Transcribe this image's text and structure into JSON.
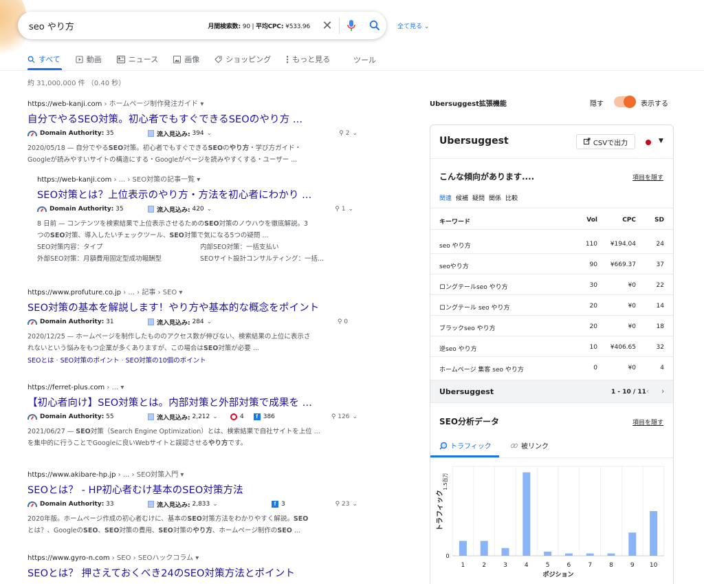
{
  "search": {
    "query": "seo やり方",
    "metrics_label": "月間検索数:",
    "metrics_volume": "90",
    "metrics_sep": " | ",
    "metrics_cpc_label": "平均CPC:",
    "metrics_cpc": "¥533.96",
    "clear_icon": "✕",
    "see_all": "全て見る",
    "see_all_caret": "⌄"
  },
  "tabs": [
    {
      "label": "すべて",
      "icon": "search-icon"
    },
    {
      "label": "動画",
      "icon": "play-icon"
    },
    {
      "label": "ニュース",
      "icon": "news-icon"
    },
    {
      "label": "画像",
      "icon": "image-icon"
    },
    {
      "label": "ショッピング",
      "icon": "tag-icon"
    },
    {
      "label": "もっと見る",
      "icon": "more-vert-icon"
    }
  ],
  "tools_label": "ツール",
  "result_count": "約 31,000,000 件 （0.40 秒）",
  "results": [
    {
      "url": "https://web-kanji.com",
      "breadcrumb": " › ホームページ制作発注ガイド ▾",
      "title": "自分でやるSEO対策。初心者でもすぐできるSEOのやり方 ...",
      "da_label": "Domain Authority:",
      "da": "35",
      "traffic_label": "流入見込み:",
      "traffic": "394",
      "links": "2",
      "snippet1": "2020/05/18 — 自分でやるSEO対策。初心者でもすぐできるSEOのやり方・学び方ガイド・",
      "snippet2": "Googleが読みやすいサイトの構造にする・Googleがページを読みやすくする・ユーザー ..."
    },
    {
      "url": "https://web-kanji.com",
      "breadcrumb": " › ... › SEO対策の記事一覧 ▾",
      "title": "SEO対策とは？上位表示のやり方・方法を初心者にわかり ...",
      "da_label": "Domain Authority:",
      "da": "35",
      "traffic_label": "流入見込み:",
      "traffic": "420",
      "links": "1",
      "snippet1": "8 日前 — コンテンツを検索結果で上位表示させるためのSEO対策のノウハウを徹底解説。3",
      "snippet2": "つのSEO対策、導入したいチェックツール、SEO対策で気になる5つの疑問 ...",
      "facts": [
        {
          "k": "SEO対策内容：",
          "v": "タイプ"
        },
        {
          "k": "内部SEO対策：",
          "v": "一括支払い"
        },
        {
          "k": "外部SEO対策：",
          "v": "月額費用固定型成功報酬型"
        },
        {
          "k": "SEOサイト設計コンサルティング：",
          "v": "一括..."
        }
      ]
    },
    {
      "url": "https://www.profuture.co.jp",
      "breadcrumb": " › ... › 記事 › SEO ▾",
      "title": "SEO対策の基本を解説します！やり方や基本的な概念をポイント",
      "da_label": "Domain Authority:",
      "da": "31",
      "traffic_label": "流入見込み:",
      "traffic": "284",
      "links": "0",
      "snippet1": "2020/12/25 — ホームページを制作したもののアクセス数が伸びない、検索結果の上位に表示さ",
      "snippet2": "れないという悩みをもつ企業が多くありますが、この場合はSEO対策が必要 ...",
      "sublinks": [
        "SEOとは",
        "SEO対策のポイント",
        "SEO対策の10個のポイント"
      ]
    },
    {
      "url": "https://ferret-plus.com",
      "breadcrumb": " › ... ▾",
      "title": "【初心者向け】SEO対策とは。内部対策と外部対策で成果を ...",
      "da_label": "Domain Authority:",
      "da": "55",
      "traffic_label": "流入見込み:",
      "traffic": "2,212",
      "pinterest": "4",
      "facebook": "386",
      "links": "126",
      "snippet1": "2021/06/27 — SEO対策（Search Engine Optimization）とは、検索結果で自社サイトを上位 ...",
      "snippet2": "を集中的に行うことでGoogleに良いWebサイトと誤認させるやり方です。"
    },
    {
      "url": "https://www.akibare-hp.jp",
      "breadcrumb": " › ... › SEO対策入門 ▾",
      "title": "SEOとは？ - HP初心者むけ基本のSEO対策方法",
      "da_label": "Domain Authority:",
      "da": "33",
      "traffic_label": "流入見込み:",
      "traffic": "2,833",
      "facebook": "3",
      "links": "23",
      "snippet1": "2020年版。ホームページ作成の初心者むけに、基本のSEO対策方法をわかりやすく解説。SEO",
      "snippet2": "とは？、GoogleのSEO、SEO対策の費用、SEO対策のやり方、ホームページ制作のSEO ..."
    },
    {
      "url": "https://www.gyro-n.com",
      "breadcrumb": " › SEO › SEOハックコラム ▾",
      "title": "SEOとは？ 押さえておくべき24のSEO対策方法とポイント"
    }
  ],
  "ext": {
    "title": "Ubersuggest拡張機能",
    "hide": "隠す",
    "show": "表示する",
    "toggle_on": true
  },
  "panel": {
    "logo": "Ubersuggest",
    "csv": "CSVで出力",
    "caret": "▼",
    "trend_title": "こんな傾向があります....",
    "hide_item": "項目を隠す",
    "subtabs": [
      "関連",
      "候補",
      "疑問",
      "関係",
      "比較"
    ],
    "table_head": {
      "kw": "キーワード",
      "vol": "Vol",
      "cpc": "CPC",
      "sd": "SD"
    },
    "rows": [
      {
        "kw": "seo やり方",
        "vol": "110",
        "cpc": "¥194.04",
        "sd": "24"
      },
      {
        "kw": "seoやり方",
        "vol": "90",
        "cpc": "¥669.37",
        "sd": "37"
      },
      {
        "kw": "ロングテールseo やり方",
        "vol": "30",
        "cpc": "¥0",
        "sd": "22"
      },
      {
        "kw": "ロングテール seo やり方",
        "vol": "20",
        "cpc": "¥0",
        "sd": "14"
      },
      {
        "kw": "ブラックseo やり方",
        "vol": "20",
        "cpc": "¥0",
        "sd": "18"
      },
      {
        "kw": "逆seo やり方",
        "vol": "10",
        "cpc": "¥406.65",
        "sd": "32"
      },
      {
        "kw": "ホームページ 集客 seo やり方",
        "vol": "0",
        "cpc": "¥0",
        "sd": "4"
      }
    ],
    "footer_logo": "Ubersuggest",
    "pagination": "1 - 10 / 11",
    "prev": "‹",
    "next": "›",
    "seo_title": "SEO分析データ",
    "tab_traffic": "トラフィック",
    "tab_backlinks": "被リンク"
  },
  "chart_data": {
    "type": "bar",
    "categories": [
      "1",
      "2",
      "3",
      "4",
      "5",
      "6",
      "7",
      "8",
      "9",
      "10"
    ],
    "values": [
      0.25,
      0.25,
      0.13,
      1.4,
      0.07,
      0.04,
      0.04,
      0.04,
      0.39,
      0.75
    ],
    "xlabel": "ポジション",
    "ylabel": "トラフィック",
    "ytick_top": "1.5百万",
    "ytick_zero": "0",
    "ylim": [
      0,
      1.5
    ],
    "bar_color": "#8ab4f8",
    "grid": true
  },
  "colors": {
    "link": "#1a0dab",
    "accent": "#1a73e8",
    "toggle": "#f26b2d"
  }
}
